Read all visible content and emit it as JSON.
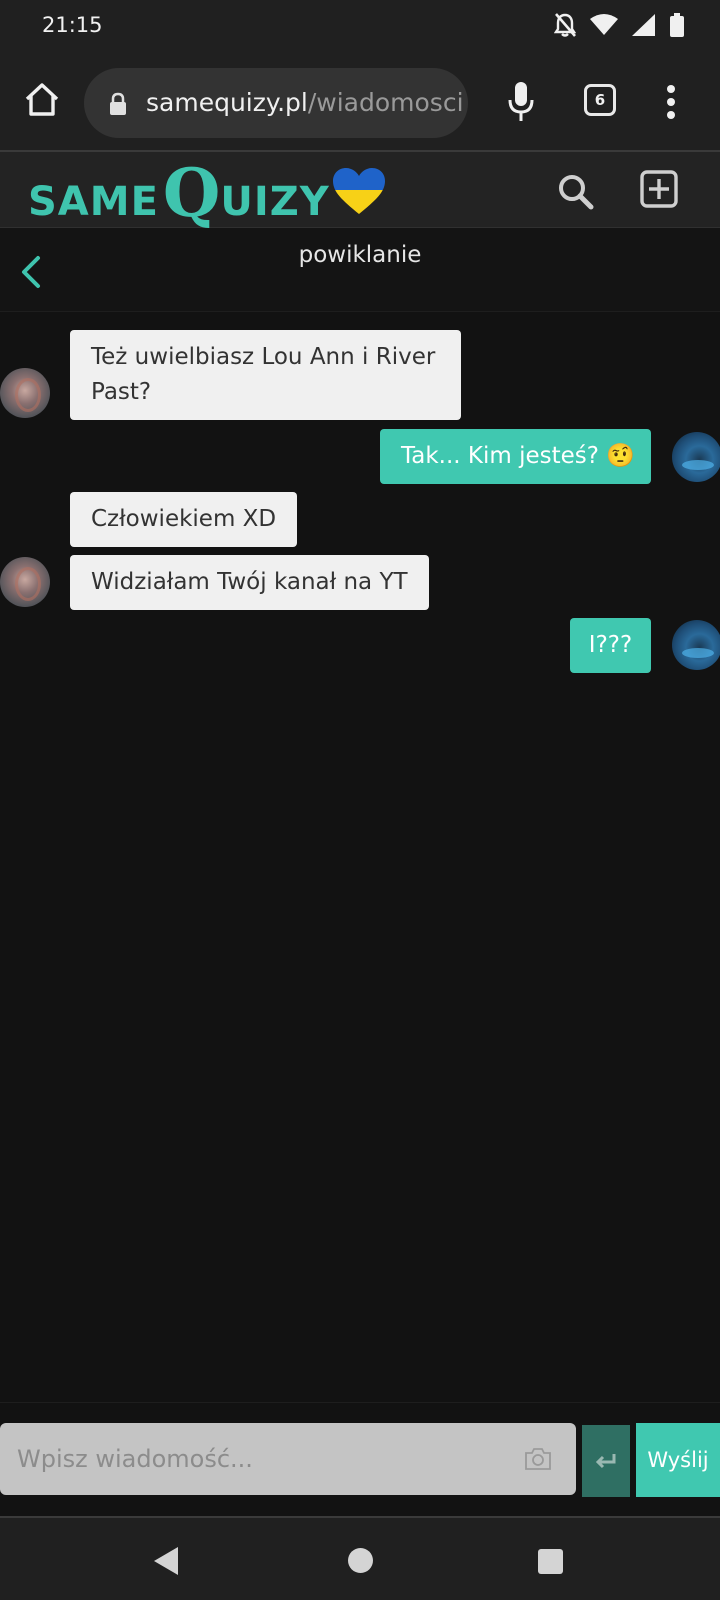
{
  "status_bar": {
    "time": "21:15",
    "icons": [
      "bell-off-icon",
      "wifi-icon",
      "signal-icon",
      "battery-icon"
    ]
  },
  "browser": {
    "url_host": "samequizy.pl",
    "url_path": "/wiadomosci",
    "tab_count": "6"
  },
  "site": {
    "logo_same": "SAME",
    "logo_q": "Q",
    "logo_uizy": "UIZY",
    "accent_color": "#3fc4ae"
  },
  "conversation": {
    "title": "powiklanie"
  },
  "messages": [
    {
      "from": "them",
      "text": "Też uwielbiasz Lou Ann i River Past?"
    },
    {
      "from": "me",
      "text": "Tak... Kim jesteś? 🤨"
    },
    {
      "from": "them",
      "text": "Człowiekiem XD"
    },
    {
      "from": "them",
      "text": "Widziałam Twój kanał na YT"
    },
    {
      "from": "me",
      "text": "I???"
    }
  ],
  "composer": {
    "placeholder": "Wpisz wiadomość...",
    "send_label": "Wyślij"
  },
  "colors": {
    "outgoing_bubble": "#40c8b0",
    "incoming_bubble": "#f0f0f0",
    "background": "#121212"
  }
}
